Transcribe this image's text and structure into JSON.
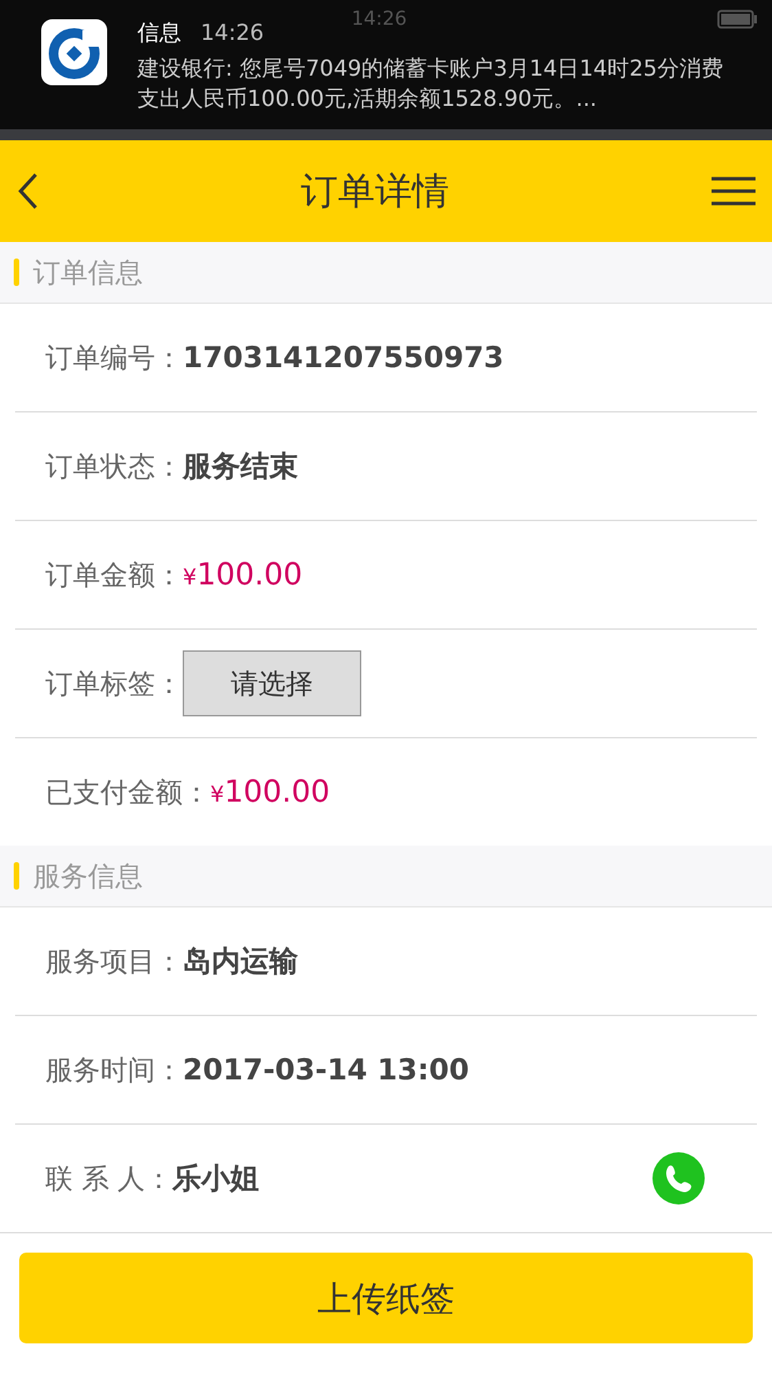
{
  "status_bar": {
    "time": "14:26"
  },
  "notification": {
    "app": "信息",
    "time": "14:26",
    "message": "建设银行: 您尾号7049的储蓄卡账户3月14日14时25分消费支出人民币100.00元,活期余额1528.90元。..."
  },
  "header": {
    "title": "订单详情"
  },
  "sections": [
    {
      "title": "订单信息",
      "rows": [
        {
          "kind": "text",
          "label": "订单编号：",
          "value": "1703141207550973"
        },
        {
          "kind": "text",
          "label": "订单状态：",
          "value": "服务结束"
        },
        {
          "kind": "price",
          "label": "订单金额：",
          "currency": "¥",
          "value": "100.00"
        },
        {
          "kind": "select",
          "label": "订单标签：",
          "placeholder": "请选择"
        },
        {
          "kind": "price",
          "label": "已支付金额：",
          "currency": "¥",
          "value": "100.00"
        }
      ]
    },
    {
      "title": "服务信息",
      "rows": [
        {
          "kind": "text",
          "label": "服务项目：",
          "value": "岛内运输"
        },
        {
          "kind": "text",
          "label": "服务时间：",
          "value": "2017-03-14 13:00"
        },
        {
          "kind": "phone",
          "label": "联 系 人：",
          "value": "乐小姐"
        }
      ]
    }
  ],
  "upload_button": "上传纸签"
}
